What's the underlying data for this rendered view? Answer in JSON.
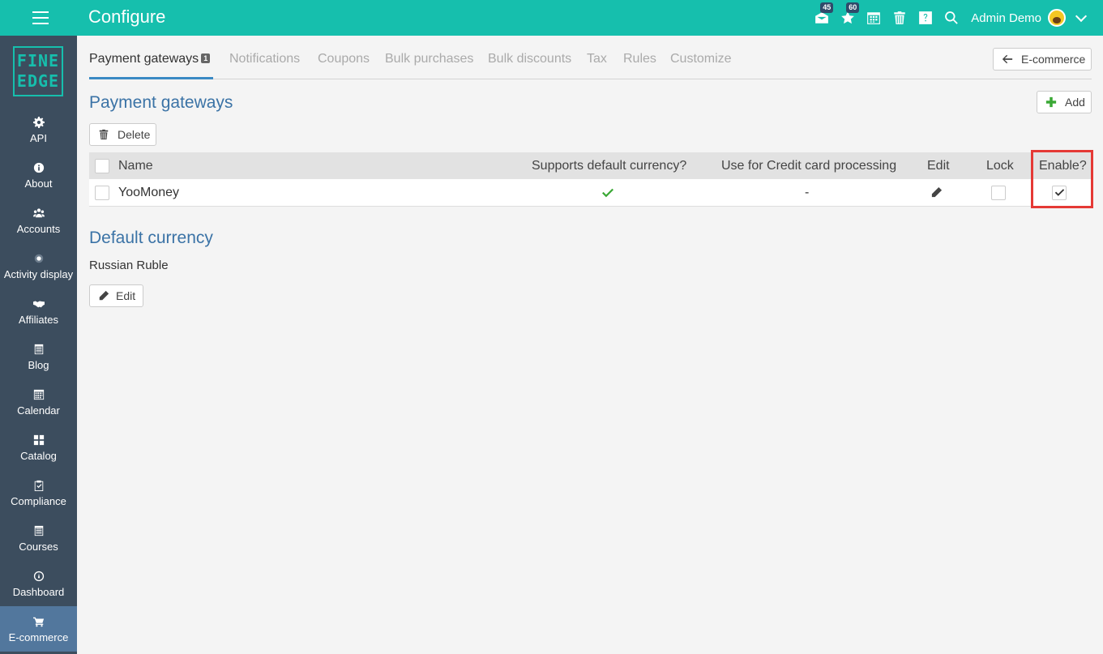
{
  "header": {
    "title": "Configure",
    "notifications": {
      "inbox_count": "45",
      "star_count": "60"
    },
    "user": "Admin Demo"
  },
  "sidebar": {
    "logo": [
      "FINE",
      "EDGE"
    ],
    "items": [
      {
        "label": "API",
        "icon": "gear-icon"
      },
      {
        "label": "About",
        "icon": "info-icon"
      },
      {
        "label": "Accounts",
        "icon": "users-icon"
      },
      {
        "label": "Activity display",
        "icon": "dot-icon"
      },
      {
        "label": "Affiliates",
        "icon": "handshake-icon"
      },
      {
        "label": "Blog",
        "icon": "blog-icon"
      },
      {
        "label": "Calendar",
        "icon": "calendar-icon"
      },
      {
        "label": "Catalog",
        "icon": "grid-icon"
      },
      {
        "label": "Compliance",
        "icon": "clipboard-icon"
      },
      {
        "label": "Courses",
        "icon": "courses-icon"
      },
      {
        "label": "Dashboard",
        "icon": "dashboard-icon"
      },
      {
        "label": "E-commerce",
        "icon": "cart-icon",
        "active": true
      }
    ]
  },
  "tabs": [
    {
      "label": "Payment gateways",
      "badge": "1",
      "active": true
    },
    {
      "label": "Notifications"
    },
    {
      "label": "Coupons"
    },
    {
      "label": "Bulk purchases"
    },
    {
      "label": "Bulk discounts"
    },
    {
      "label": "Tax"
    },
    {
      "label": "Rules"
    },
    {
      "label": "Customize"
    }
  ],
  "back_button": "E-commerce",
  "gateways": {
    "title": "Payment gateways",
    "add_label": "Add",
    "delete_label": "Delete",
    "columns": {
      "name": "Name",
      "supports_default": "Supports default currency?",
      "credit_card": "Use for Credit card processing",
      "edit": "Edit",
      "lock": "Lock",
      "enable": "Enable?"
    },
    "rows": [
      {
        "name": "YooMoney",
        "supports_default": true,
        "credit_card": "-",
        "locked": false,
        "enabled": true
      }
    ]
  },
  "default_currency": {
    "title": "Default currency",
    "value": "Russian Ruble",
    "edit_label": "Edit"
  },
  "colors": {
    "topbar": "#16bfad",
    "sidebar": "#3c4d5e",
    "sidebar_active": "#52779d",
    "section_title": "#3b73a6",
    "highlight": "#e53935",
    "check": "#3aa835"
  }
}
